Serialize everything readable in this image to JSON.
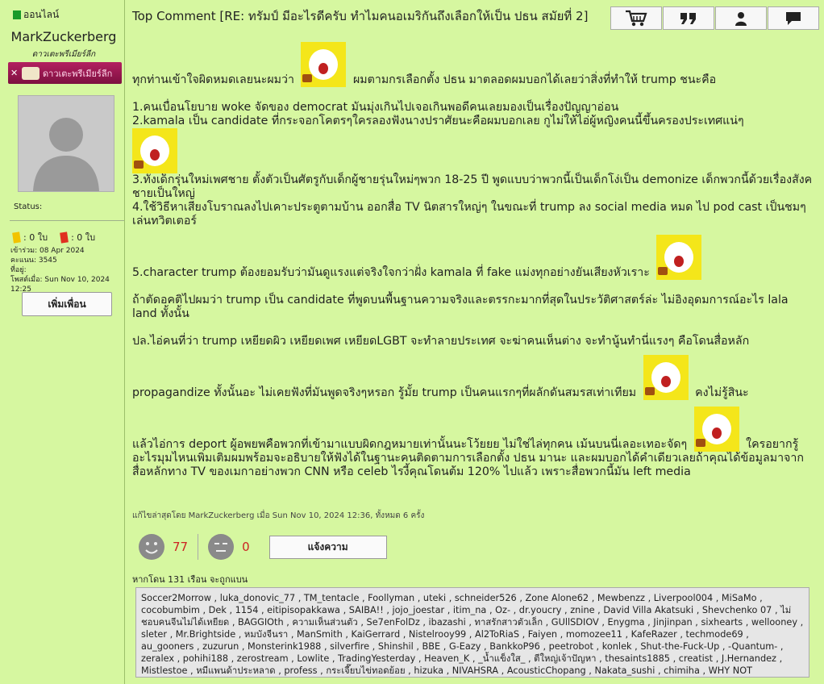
{
  "sidebar": {
    "online_label": "ออนไลน์",
    "username": "MarkZuckerberg",
    "rank_title": "ดาวเตะพรีเมียร์ลีก",
    "rank_badge_text": "ดาวเตะพรีเมียร์ลีก",
    "status_label": "Status:",
    "yellow_cards": ": 0 ใบ",
    "red_cards": ": 0 ใบ",
    "joined": "เข้าร่วม: 08 Apr 2024",
    "points": "คะแนน: 3545",
    "location": "ที่อยู่:",
    "last_post": "โพสต์เมื่อ: Sun Nov 10, 2024 12:25",
    "add_friend_label": "เพิ่มเพื่อน"
  },
  "post": {
    "title": "Top Comment [RE: ทรัมป์ มีอะไรดีครับ ทำไมคนอเมริกันถึงเลือกให้เป็น ปธน สมัยที่ 2]",
    "toolbar_icons": [
      "cart-icon",
      "quote-icon",
      "user-icon",
      "message-icon"
    ],
    "line_intro_a": "ทุกท่านเข้าใจผิดหมดเลยนะผมว่า",
    "line_intro_b": "ผมตามกรเลือกตั้ง ปธน มาตลอดผมบอกได้เลยว่าสิ่งที่ทำให้ trump ชนะคือ",
    "point1": "1.คนเบื่อนโยบาย woke จัดของ democrat มันมุ่งเกินไปเจอเกินพอดีคนเลยมองเป็นเรื่องปัญญาอ่อน",
    "point2": "2.kamala เป็น candidate ที่กระจอกโคตรๆใครลองฟังนางปราศัยนะคือผมบอกเลย กูไม่ให้ไอ่ผู้หญิงคนนี้ขึ้นครองประเทศแน่ๆ",
    "point3": "3.ทั้งเด็กรุ่นใหม่เพศชาย ตั้งตัวเป็นศัตรูกับเด็กผู้ชายรุ่นใหม่ๆพวก 18-25 ปี พูดแบบว่าพวกนี้เป็นเด็กโง่เป็น demonize เด็กพวกนี้ด้วยเรื่องสังคชายเป็นใหญ่",
    "point4": "4.ใช้วิธีหาเสียงโบราณลงไปเคาะประตูตามบ้าน ออกสื่อ TV นิตสารใหญ่ๆ ในขณะที่ trump ลง social media หมด ไป pod cast เป็นชมๆ เล่นทวิตเตอร์",
    "point5": "5.character trump ต้องยอมรับว่ามันดูแรงแต่จริงใจกว่าฝั่ง kamala ที่ fake แม่งทุกอย่างยันเสียงหัวเราะ",
    "para_ideology": "ถ้าตัดอคติไปผมว่า trump เป็น candidate ที่พูดบนพื้นฐานความจริงและตรรกะมากที่สุดในประวัติศาสตร์ล่ะ ไม่อิงอุดมการณ์อะไร lala land ทั้งนั้น",
    "para_ps": "ปล.ไอ่คนที่ว่า trump เหยียดผิว เหยียดเพศ เหยียดLGBT จะทำลายประเทศ จะฆ่าคนเห็นต่าง จะทำนู้นทำนี่แรงๆ คือโดนสื่อหลัก",
    "para_prop_a": "propagandize ทั้งนั้นอะ ไม่เคยฟังที่มันพูดจริงๆหรอก รู้มั้ย trump เป็นคนแรกๆที่ผลักดันสมรสเท่าเทียม",
    "para_prop_b": "คงไม่รู้สินะ",
    "para_deport_a": "แล้วไอ่การ deport ผู้อพยพคือพวกที่เข้ามาแบบผิดกฎหมายเท่านั้นนะโว้ยยย ไม่ใช่ไล่ทุกคน เม้นบนนี่เลอะเทอะจัดๆ",
    "para_deport_b": "ใครอยากรู้อะไรมุมไหนเพิ่มเติมผมพร้อมจะอธิบายให้ฟังได้ในฐานะคนติดตามการเลือกตั้ง ปธน มานะ และผมบอกได้คำเดียวเลยถ้าคุณได้ข้อมูลมาจากสื่อหลักทาง TV ของเมกาอย่างพวก CNN หรือ celeb ไรงี้คุณโดนต้ม 120% ไปแล้ว เพราะสื่อพวกนี้มัน left media",
    "edit_note": "แก้ไขล่าสุดโดย MarkZuckerberg เมื่อ Sun Nov 10, 2024 12:36, ทั้งหมด 6 ครั้ง"
  },
  "reactions": {
    "like_count": "77",
    "dislike_count": "0",
    "report_label": "แจ้งความ"
  },
  "ban": {
    "label": "หากโดน 131 เรือน จะถูกแบน",
    "list": "Soccer2Morrow , luka_donovic_77 , TM_tentacle , Foollyman , uteki , schneider526 , Zone Alone62 , Mewbenzz , Liverpool004 , MiSaMo , cocobumbim , Dek , 1154 , eitipisopakkawa , SAIBA!! , jojo_joestar , itim_na , Oz- , dr.youcry , znine , David Villa Akatsuki , Shevchenko 07 , ไม่ชอบคนจีนไม่ได้เหยียด , BAGGIOth , ความเห็นส่วนตัว , Se7enFolDz , ibazashi , ทาสรักสาวตัวเล็ก , GUllSDIOV , Enygma , Jinjinpan , sixhearts , wellooney , sleter , Mr.Brightside , หมบังจีนรา , ManSmith , KaiGerrard , Nistelrooy99 , Al2ToRiaS , Faiyen , momozee11 , KafeRazer , techmode69 , au_gooners , zuzurun , Monsterink1988 , silverfire , Shinshil , BBE , G-Eazy , BankkoP96 , peetrobot , konlek , Shut-the-Fuck-Up , -Quantum- , zeralex , pohihi188 , zerostream , Lowlite , TradingYesterday , Heaven_K , _น้ำแข็งใส_ , ตีใหญ่เจ้าปัญหา , thesaints1885 , creatist , J.Hernandez , Mistlestoe , หมีแพนด้าประหลาด , profess , กระเจี๊ยบไข่ทอดย้อย , hizuka , NIVAHSRA , AcousticChopang , Nakata_sushi , chimiha , WHY NOT"
  },
  "colors": {
    "background": "#d6f7a0",
    "online_dot": "#1a9a2a",
    "badge": "#b32060",
    "count_red": "#cc2222"
  }
}
